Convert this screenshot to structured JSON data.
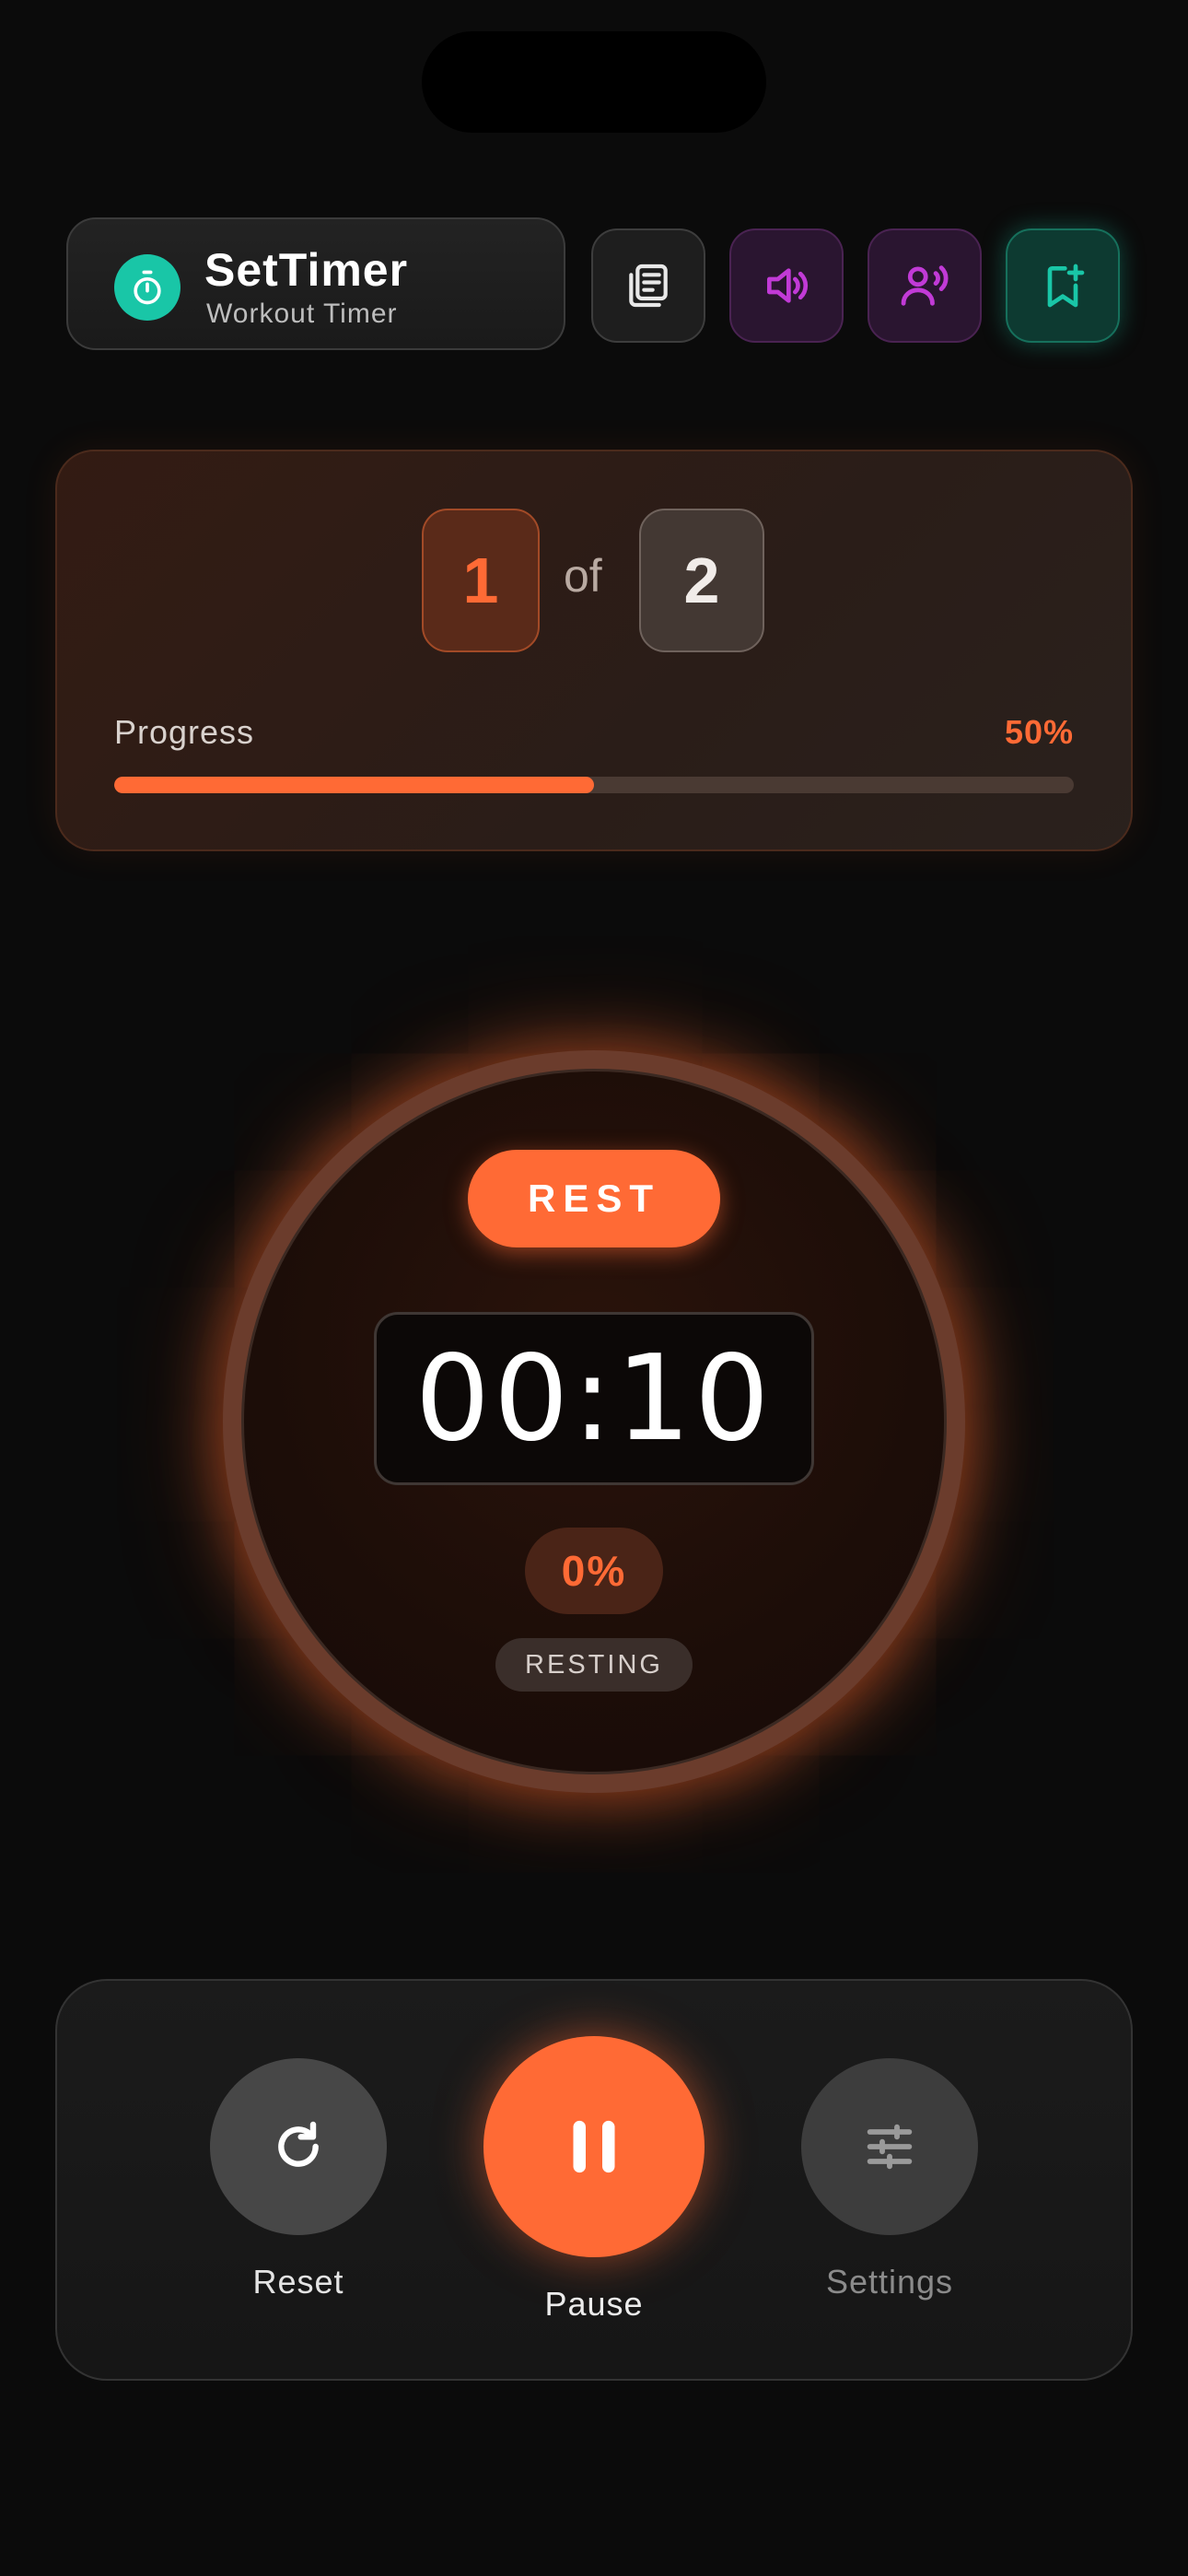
{
  "header": {
    "title": "SetTimer",
    "subtitle": "Workout Timer",
    "buttons": [
      {
        "icon": "library-icon"
      },
      {
        "icon": "volume-icon"
      },
      {
        "icon": "voice-icon"
      },
      {
        "icon": "bookmark-add-icon"
      }
    ],
    "accent": "#19c6a7"
  },
  "sets": {
    "current": "1",
    "separator": "of",
    "total": "2"
  },
  "progress": {
    "label": "Progress",
    "percent_text": "50%",
    "value": 0.5
  },
  "timer": {
    "phase": "REST",
    "time": "00:10",
    "phase_percent": "0%",
    "status": "RESTING"
  },
  "controls": {
    "reset_label": "Reset",
    "pause_label": "Pause",
    "settings_label": "Settings"
  },
  "colors": {
    "accent": "#ff6a35",
    "background": "#0b0b0b"
  }
}
